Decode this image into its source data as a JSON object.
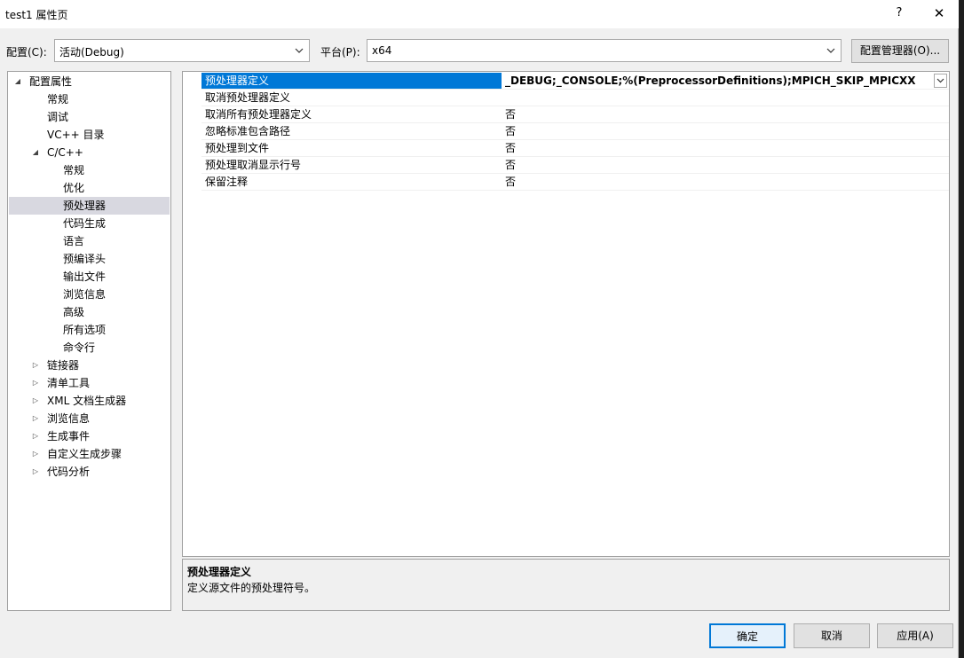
{
  "window": {
    "title": "test1 属性页",
    "help_glyph": "?",
    "close_glyph": "✕"
  },
  "toolbar": {
    "config_label": "配置(C):",
    "config_value": "活动(Debug)",
    "platform_label": "平台(P):",
    "platform_value": "x64",
    "config_manager_label": "配置管理器(O)..."
  },
  "tree": {
    "items": [
      {
        "label": "配置属性",
        "expander": "◢"
      },
      {
        "label": "常规"
      },
      {
        "label": "调试"
      },
      {
        "label": "VC++ 目录"
      },
      {
        "label": "C/C++",
        "expander": "◢"
      },
      {
        "label": "常规"
      },
      {
        "label": "优化"
      },
      {
        "label": "预处理器"
      },
      {
        "label": "代码生成"
      },
      {
        "label": "语言"
      },
      {
        "label": "预编译头"
      },
      {
        "label": "输出文件"
      },
      {
        "label": "浏览信息"
      },
      {
        "label": "高级"
      },
      {
        "label": "所有选项"
      },
      {
        "label": "命令行"
      },
      {
        "label": "链接器",
        "expander": "▷"
      },
      {
        "label": "清单工具",
        "expander": "▷"
      },
      {
        "label": "XML 文档生成器",
        "expander": "▷"
      },
      {
        "label": "浏览信息",
        "expander": "▷"
      },
      {
        "label": "生成事件",
        "expander": "▷"
      },
      {
        "label": "自定义生成步骤",
        "expander": "▷"
      },
      {
        "label": "代码分析",
        "expander": "▷"
      }
    ]
  },
  "properties": {
    "rows": [
      {
        "name": "预处理器定义",
        "value": "_DEBUG;_CONSOLE;%(PreprocessorDefinitions);MPICH_SKIP_MPICXX"
      },
      {
        "name": "取消预处理器定义",
        "value": ""
      },
      {
        "name": "取消所有预处理器定义",
        "value": "否"
      },
      {
        "name": "忽略标准包含路径",
        "value": "否"
      },
      {
        "name": "预处理到文件",
        "value": "否"
      },
      {
        "name": "预处理取消显示行号",
        "value": "否"
      },
      {
        "name": "保留注释",
        "value": "否"
      }
    ]
  },
  "description": {
    "title": "预处理器定义",
    "text": "定义源文件的预处理符号。"
  },
  "buttons": {
    "ok": "确定",
    "cancel": "取消",
    "apply": "应用(A)"
  },
  "colors": {
    "selection": "#0078d7",
    "tree_selection": "#d8d8e0",
    "window_bg": "#f0f0f0"
  }
}
